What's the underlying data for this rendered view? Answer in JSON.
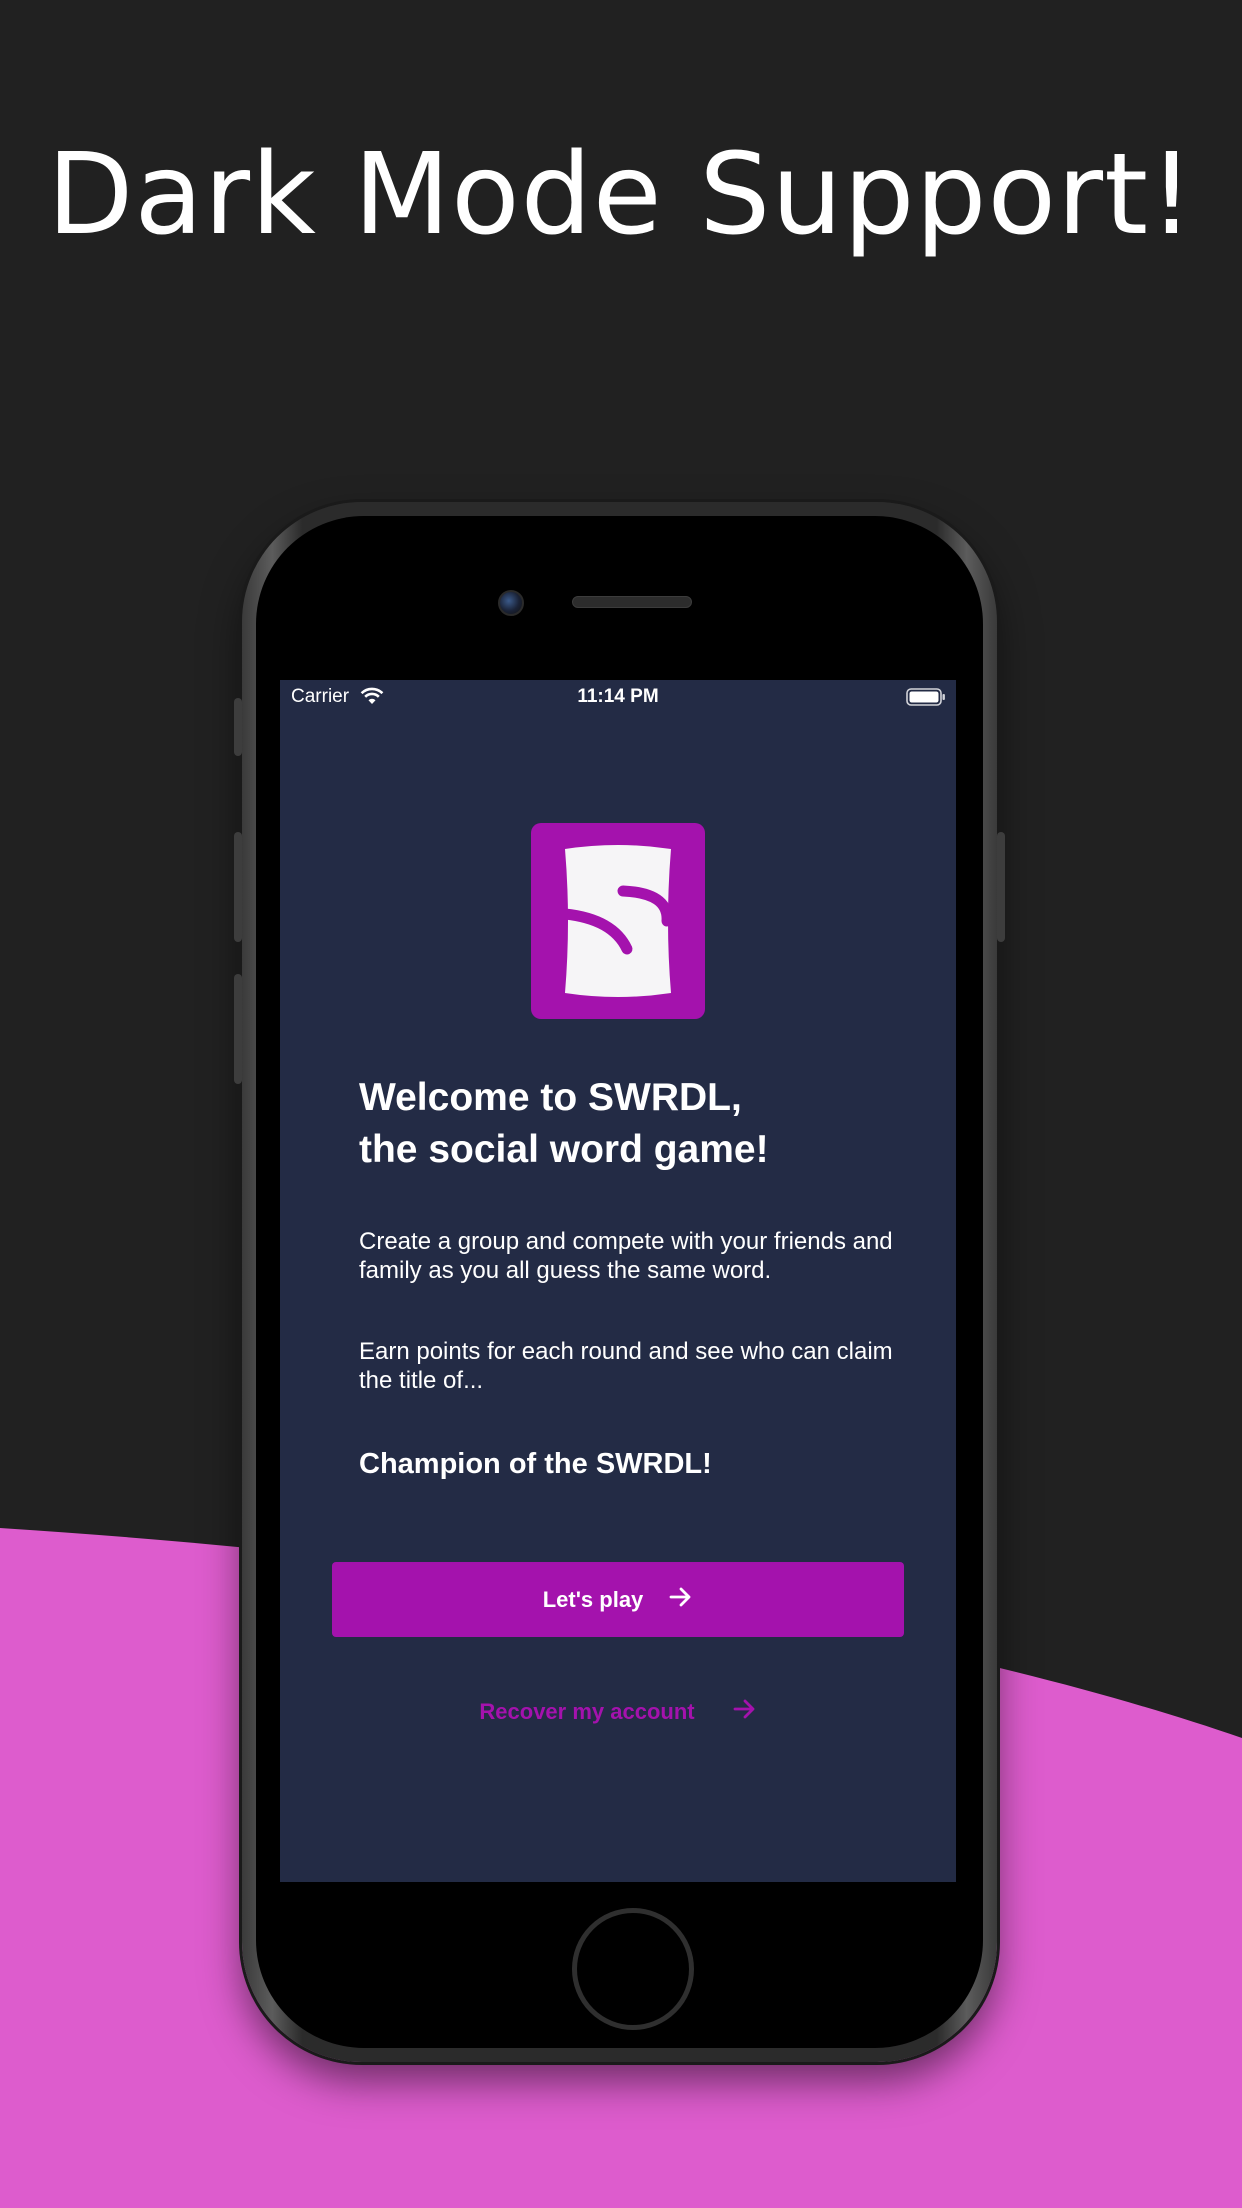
{
  "colors": {
    "background": "#212121",
    "wave": "#dd5ccd",
    "screen_background": "#232b45",
    "accent": "#a412ad",
    "text": "#ffffff"
  },
  "promo": {
    "headline": "Dark Mode Support!"
  },
  "status_bar": {
    "carrier": "Carrier",
    "time": "11:14 PM",
    "icons": [
      "wifi-icon",
      "battery-icon"
    ]
  },
  "welcome": {
    "logo_icon": "swrdl-logo-icon",
    "title_line1": "Welcome to SWRDL,",
    "title_line2": "the social word game!",
    "paragraph1": "Create a group and compete with your friends and family as you all guess the same word.",
    "paragraph2": "Earn points for each round and see who can claim the title of...",
    "champion": "Champion of the SWRDL!"
  },
  "actions": {
    "play_label": "Let's play",
    "play_icon": "arrow-right-icon",
    "recover_label": "Recover my account",
    "recover_icon": "arrow-right-icon"
  }
}
